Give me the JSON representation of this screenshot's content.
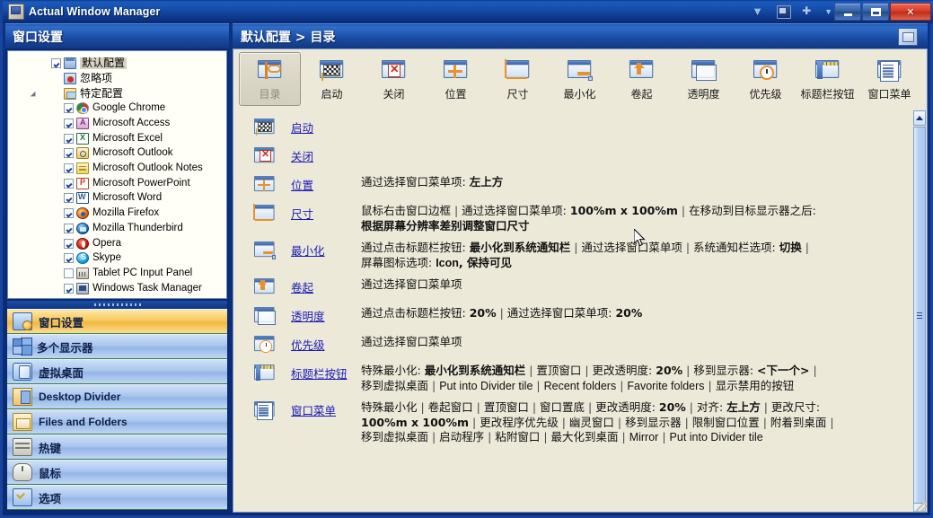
{
  "window": {
    "title": "Actual Window Manager",
    "icon": "app-icon",
    "titlebar_extra_icons": [
      "chevrons-down-icon",
      "screen-icon",
      "pin-icon"
    ],
    "buttons": {
      "minimize": "_",
      "maximize": "□",
      "close": "✕"
    }
  },
  "left_header": {
    "title": "窗口设置"
  },
  "right_header": {
    "title": "默认配置 > 目录",
    "icon": "window-icon"
  },
  "tree": {
    "nodes": [
      {
        "label": "默认配置",
        "icon": "window-config-icon",
        "checked": true,
        "selected": true,
        "level": 1,
        "cjk": true
      },
      {
        "label": "忽略项",
        "icon": "ignore-icon",
        "checked": null,
        "selected": false,
        "level": 1,
        "cjk": true
      },
      {
        "label": "特定配置",
        "icon": "specific-config-icon",
        "checked": null,
        "selected": false,
        "level": 1,
        "cjk": true,
        "expander": true
      },
      {
        "label": "Google Chrome",
        "icon": "chrome-icon",
        "checked": true,
        "selected": false,
        "level": 2,
        "cjk": false
      },
      {
        "label": "Microsoft Access",
        "icon": "access-icon",
        "checked": true,
        "selected": false,
        "level": 2,
        "cjk": false
      },
      {
        "label": "Microsoft Excel",
        "icon": "excel-icon",
        "checked": true,
        "selected": false,
        "level": 2,
        "cjk": false
      },
      {
        "label": "Microsoft Outlook",
        "icon": "outlook-icon",
        "checked": true,
        "selected": false,
        "level": 2,
        "cjk": false
      },
      {
        "label": "Microsoft Outlook Notes",
        "icon": "outlook-notes-icon",
        "checked": true,
        "selected": false,
        "level": 2,
        "cjk": false
      },
      {
        "label": "Microsoft PowerPoint",
        "icon": "powerpoint-icon",
        "checked": true,
        "selected": false,
        "level": 2,
        "cjk": false
      },
      {
        "label": "Microsoft Word",
        "icon": "word-icon",
        "checked": true,
        "selected": false,
        "level": 2,
        "cjk": false
      },
      {
        "label": "Mozilla Firefox",
        "icon": "firefox-icon",
        "checked": true,
        "selected": false,
        "level": 2,
        "cjk": false
      },
      {
        "label": "Mozilla Thunderbird",
        "icon": "thunderbird-icon",
        "checked": true,
        "selected": false,
        "level": 2,
        "cjk": false
      },
      {
        "label": "Opera",
        "icon": "opera-icon",
        "checked": true,
        "selected": false,
        "level": 2,
        "cjk": false
      },
      {
        "label": "Skype",
        "icon": "skype-icon",
        "checked": true,
        "selected": false,
        "level": 2,
        "cjk": false
      },
      {
        "label": "Tablet PC Input Panel",
        "icon": "tablet-pc-icon",
        "checked": false,
        "selected": false,
        "level": 2,
        "cjk": false
      },
      {
        "label": "Windows Task Manager",
        "icon": "task-manager-icon",
        "checked": true,
        "selected": false,
        "level": 2,
        "cjk": false
      }
    ]
  },
  "nav": {
    "items": [
      {
        "label": "窗口设置",
        "icon": "window-settings-icon",
        "active": true,
        "latin": false
      },
      {
        "label": "多个显示器",
        "icon": "multi-monitor-icon",
        "active": false,
        "latin": false
      },
      {
        "label": "虚拟桌面",
        "icon": "virtual-desktop-icon",
        "active": false,
        "latin": false
      },
      {
        "label": "Desktop Divider",
        "icon": "desktop-divider-icon",
        "active": false,
        "latin": true
      },
      {
        "label": "Files and Folders",
        "icon": "files-folders-icon",
        "active": false,
        "latin": true
      },
      {
        "label": "热键",
        "icon": "hotkey-icon",
        "active": false,
        "latin": false
      },
      {
        "label": "鼠标",
        "icon": "mouse-icon",
        "active": false,
        "latin": false
      },
      {
        "label": "选项",
        "icon": "options-icon",
        "active": false,
        "latin": false
      }
    ]
  },
  "toolbar": {
    "buttons": [
      {
        "label": "目录",
        "icon": "directory-icon",
        "selected": true
      },
      {
        "label": "启动",
        "icon": "startup-icon",
        "selected": false
      },
      {
        "label": "关闭",
        "icon": "close-icon",
        "selected": false
      },
      {
        "label": "位置",
        "icon": "position-icon",
        "selected": false
      },
      {
        "label": "尺寸",
        "icon": "size-icon",
        "selected": false
      },
      {
        "label": "最小化",
        "icon": "minimize-icon",
        "selected": false
      },
      {
        "label": "卷起",
        "icon": "rollup-icon",
        "selected": false
      },
      {
        "label": "透明度",
        "icon": "transparency-icon",
        "selected": false
      },
      {
        "label": "优先级",
        "icon": "priority-icon",
        "selected": false
      },
      {
        "label": "标题栏按钮",
        "icon": "titlebar-buttons-icon",
        "selected": false
      },
      {
        "label": "窗口菜单",
        "icon": "window-menu-icon",
        "selected": false
      }
    ]
  },
  "list": {
    "rows": [
      {
        "link": "启动",
        "icon": "startup-icon",
        "desc_html": ""
      },
      {
        "link": "关闭",
        "icon": "close-icon",
        "desc_html": ""
      },
      {
        "link": "位置",
        "icon": "position-icon",
        "desc_html": "通过选择窗口菜单项: <b>左上方</b>"
      },
      {
        "link": "尺寸",
        "icon": "size-icon",
        "desc_html": "鼠标右击窗口边框 <span class=\"sep\">|</span> 通过选择窗口菜单项: <b>100%m x 100%m</b> <span class=\"sep\">|</span> 在移动到目标显示器之后:<br><b>根据屏幕分辨率差别调整窗口尺寸</b>"
      },
      {
        "link": "最小化",
        "icon": "minimize-icon",
        "desc_html": "通过点击标题栏按钮: <b>最小化到系统通知栏</b> <span class=\"sep\">|</span> 通过选择窗口菜单项 <span class=\"sep\">|</span> 系统通知栏选项: <b>切换</b> <span class=\"sep\">|</span><br>屏幕图标选项: <b class=\"lat\">Icon</b><b>, 保持可见</b>"
      },
      {
        "link": "卷起",
        "icon": "rollup-icon",
        "desc_html": "通过选择窗口菜单项"
      },
      {
        "link": "透明度",
        "icon": "transparency-icon",
        "desc_html": "通过点击标题栏按钮: <b>20%</b> <span class=\"sep\">|</span> 通过选择窗口菜单项: <b>20%</b>"
      },
      {
        "link": "优先级",
        "icon": "priority-icon",
        "desc_html": "通过选择窗口菜单项"
      },
      {
        "link": "标题栏按钮",
        "icon": "titlebar-buttons-icon",
        "desc_html": "特殊最小化: <b>最小化到系统通知栏</b> <span class=\"sep\">|</span> 置顶窗口 <span class=\"sep\">|</span> 更改透明度: <b>20%</b> <span class=\"sep\">|</span> 移到显示器: <b>&lt;下一个&gt;</b> <span class=\"sep\">|</span><br>移到虚拟桌面 <span class=\"sep\">|</span> <span class=\"lat\">Put into Divider tile</span> <span class=\"sep\">|</span> <span class=\"lat\">Recent folders</span> <span class=\"sep\">|</span> <span class=\"lat\">Favorite folders</span> <span class=\"sep\">|</span> 显示禁用的按钮"
      },
      {
        "link": "窗口菜单",
        "icon": "window-menu-icon",
        "desc_html": "特殊最小化 <span class=\"sep\">|</span> 卷起窗口 <span class=\"sep\">|</span> 置顶窗口 <span class=\"sep\">|</span> 窗口置底 <span class=\"sep\">|</span> 更改透明度: <b>20%</b> <span class=\"sep\">|</span> 对齐: <b>左上方</b> <span class=\"sep\">|</span> 更改尺寸:<br><b>100%m x 100%m</b> <span class=\"sep\">|</span> 更改程序优先级 <span class=\"sep\">|</span> 幽灵窗口 <span class=\"sep\">|</span> 移到显示器 <span class=\"sep\">|</span> 限制窗口位置 <span class=\"sep\">|</span> 附着到桌面 <span class=\"sep\">|</span><br>移到虚拟桌面 <span class=\"sep\">|</span> 启动程序 <span class=\"sep\">|</span> 粘附窗口 <span class=\"sep\">|</span> 最大化到桌面 <span class=\"sep\">|</span> <span class=\"lat\">Mirror</span> <span class=\"sep\">|</span> <span class=\"lat\">Put into Divider tile</span>"
      }
    ]
  },
  "scrollbar": {
    "up_arrow": "▲",
    "thumb_grip": "grip"
  },
  "colors": {
    "title_blue": "#1d5bbd",
    "panel_beige": "#ece9d8",
    "link_blue": "#1b1bb8",
    "nav_active": "#f0b93f",
    "nav_normal": "#a9c6ee",
    "tree_bg": "#fffef7"
  }
}
